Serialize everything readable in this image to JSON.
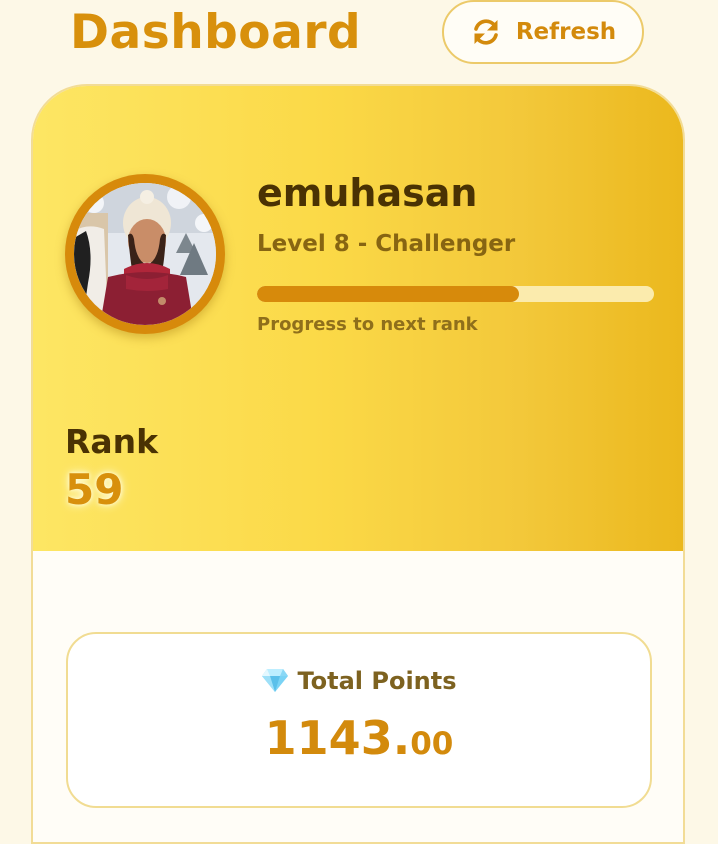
{
  "header": {
    "title": "Dashboard",
    "refresh_label": "Refresh"
  },
  "profile": {
    "username": "emuhasan",
    "level": "Level 8 - Challenger",
    "progress_fraction": 0.66,
    "progress_label": "Progress to next rank",
    "rank_label": "Rank",
    "rank_value": "59"
  },
  "points": {
    "label": "Total Points",
    "value_integer": "1143.",
    "value_decimal": "00"
  },
  "icons": {
    "refresh": "refresh-icon",
    "points": "gem-icon"
  },
  "colors": {
    "accent": "#d8900c",
    "dark_text": "#4a3203",
    "page_background": "#fdf8e7"
  }
}
